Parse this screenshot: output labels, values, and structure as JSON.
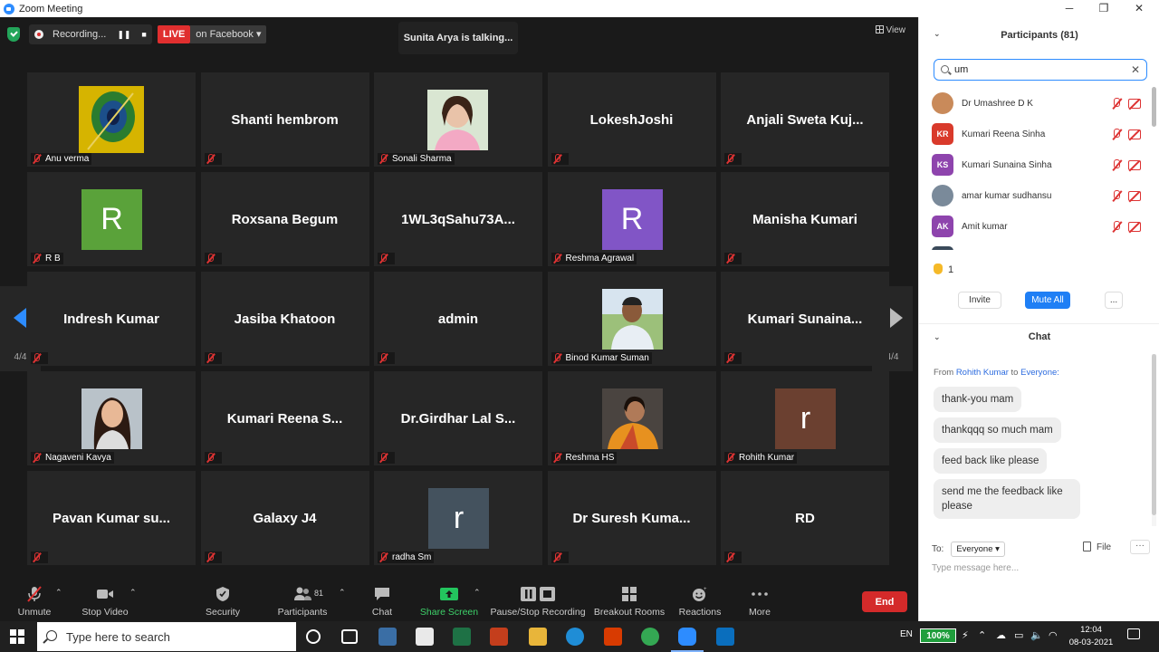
{
  "window": {
    "title": "Zoom Meeting"
  },
  "meeting": {
    "recording_label": "Recording...",
    "live_label": "LIVE",
    "live_target": "on Facebook",
    "talking": "Sunita Arya is talking...",
    "view_label": "View",
    "page_indicator": "4/4"
  },
  "tiles": [
    {
      "name": "Anu verma",
      "kind": "photo-feather"
    },
    {
      "name": "Shanti hembrom",
      "kind": "text"
    },
    {
      "name": "Sonali Sharma",
      "kind": "photo-woman"
    },
    {
      "name": "LokeshJoshi",
      "kind": "text"
    },
    {
      "name": "Anjali Sweta Kuj...",
      "kind": "text"
    },
    {
      "name": "R B",
      "kind": "avatar",
      "letter": "R",
      "color": "#5aa23a"
    },
    {
      "name": "Roxsana Begum",
      "kind": "text"
    },
    {
      "name": "1WL3qSahu73A...",
      "kind": "text"
    },
    {
      "name": "Reshma Agrawal",
      "kind": "avatar",
      "letter": "R",
      "color": "#8155c6"
    },
    {
      "name": "Manisha Kumari",
      "kind": "text"
    },
    {
      "name": "Indresh Kumar",
      "kind": "text"
    },
    {
      "name": "Jasiba Khatoon",
      "kind": "text"
    },
    {
      "name": "admin",
      "kind": "text"
    },
    {
      "name": "Binod Kumar Suman",
      "kind": "photo-man"
    },
    {
      "name": "Kumari Sunaina...",
      "kind": "text"
    },
    {
      "name": "Nagaveni Kavya",
      "kind": "photo-girl"
    },
    {
      "name": "Kumari Reena S...",
      "kind": "text"
    },
    {
      "name": "Dr.Girdhar Lal S...",
      "kind": "text"
    },
    {
      "name": "Reshma HS",
      "kind": "photo-saree"
    },
    {
      "name": "Rohith Kumar",
      "kind": "avatar",
      "letter": "r",
      "color": "#6b4030"
    },
    {
      "name": "Pavan Kumar su...",
      "kind": "text"
    },
    {
      "name": "Galaxy J4",
      "kind": "text"
    },
    {
      "name": "radha Sm",
      "kind": "avatar",
      "letter": "r",
      "color": "#44525e"
    },
    {
      "name": "Dr Suresh Kuma...",
      "kind": "text"
    },
    {
      "name": "RD",
      "kind": "text"
    }
  ],
  "toolbar": {
    "unmute": "Unmute",
    "stop_video": "Stop Video",
    "security": "Security",
    "participants": "Participants",
    "participants_count": "81",
    "chat": "Chat",
    "share_screen": "Share Screen",
    "pause_stop_recording": "Pause/Stop Recording",
    "breakout_rooms": "Breakout Rooms",
    "reactions": "Reactions",
    "more": "More",
    "end": "End"
  },
  "participants_panel": {
    "title": "Participants (81)",
    "search_value": "um",
    "list": [
      {
        "name": "Dr Umashree D K",
        "initials": "",
        "color": "#c98a5a"
      },
      {
        "name": "Kumari Reena Sinha",
        "initials": "KR",
        "color": "#d93a2b"
      },
      {
        "name": "Kumari Sunaina Sinha",
        "initials": "KS",
        "color": "#8e44ad"
      },
      {
        "name": "amar kumar sudhansu",
        "initials": "",
        "color": "#7a8a9a"
      },
      {
        "name": "Amit kumar",
        "initials": "AK",
        "color": "#8e44ad"
      }
    ],
    "raised_count": "1",
    "invite": "Invite",
    "mute_all": "Mute All",
    "more": "..."
  },
  "chat": {
    "title": "Chat",
    "from_prefix": "From",
    "from_name": "Rohith Kumar",
    "to_word": "to",
    "to_target": "Everyone:",
    "messages": [
      "thank-you mam",
      "thankqqq so much mam",
      "feed back like please",
      "send me the feedback like please"
    ],
    "to_label": "To:",
    "recipient": "Everyone",
    "file_label": "File",
    "more": "···",
    "placeholder": "Type message here..."
  },
  "taskbar": {
    "search_placeholder": "Type here to search",
    "lang": "EN",
    "battery": "100%",
    "time": "12:04",
    "date": "08-03-2021"
  },
  "colors": {
    "accent": "#2d8cff",
    "end": "#d42a2a",
    "live": "#e02f2f"
  }
}
